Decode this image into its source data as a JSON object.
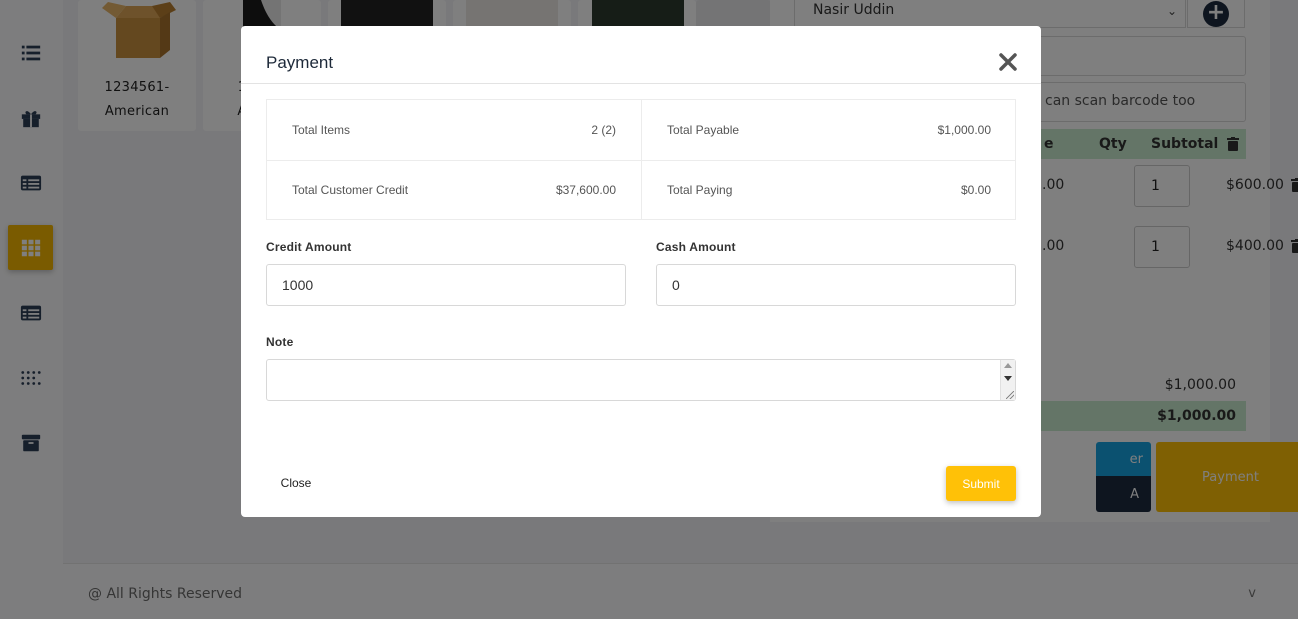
{
  "background": {
    "products": [
      {
        "name_line1": "1234561-",
        "name_line2": "American"
      },
      {
        "name_line1": "1",
        "name_line2": "A"
      }
    ],
    "cart": {
      "customer": "Nasir Uddin",
      "barcode_placeholder": "can scan barcode too",
      "columns": {
        "price_fragment": "e",
        "qty": "Qty",
        "subtotal": "Subtotal"
      },
      "rows": [
        {
          "price_fragment": ".00",
          "qty": "1",
          "subtotal": "$600.00"
        },
        {
          "price_fragment": ".00",
          "qty": "1",
          "subtotal": "$400.00"
        }
      ],
      "total": "$1,000.00",
      "grand_total": "$1,000.00",
      "btn_fragment_1": "er",
      "btn_fragment_2": "A",
      "payment_label": "Payment"
    },
    "footer": {
      "text": "@ All Rights Reserved",
      "version": "v"
    }
  },
  "modal": {
    "title": "Payment",
    "summary": {
      "total_items_label": "Total Items",
      "total_items_value": "2 (2)",
      "total_payable_label": "Total Payable",
      "total_payable_value": "$1,000.00",
      "customer_credit_label": "Total Customer Credit",
      "customer_credit_value": "$37,600.00",
      "total_paying_label": "Total Paying",
      "total_paying_value": "$0.00"
    },
    "credit_amount_label": "Credit Amount",
    "credit_amount_value": "1000",
    "cash_amount_label": "Cash Amount",
    "cash_amount_value": "0",
    "note_label": "Note",
    "note_value": "",
    "close_label": "Close",
    "submit_label": "Submit"
  },
  "colors": {
    "accent": "#ffc107",
    "sidebar_active": "#f5b600",
    "cart_header": "#c8ebcf",
    "dark": "#1c2a3e"
  }
}
